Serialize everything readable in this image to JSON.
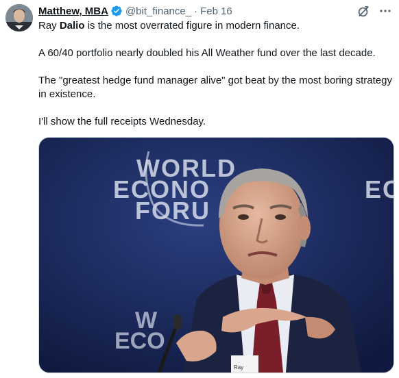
{
  "tweet": {
    "author_name": "Matthew, MBA",
    "handle": "@bit_finance_",
    "separator": "·",
    "date": "Feb 16",
    "body": {
      "line1_prefix": "Ray ",
      "line1_bold": "Dalio",
      "line1_suffix": " is the most overrated figure in modern finance.",
      "para2": "A 60/40 portfolio nearly doubled his All Weather fund over the last decade.",
      "para3": "The \"greatest hedge fund manager alive\" got beat by the most boring strategy in existence.",
      "para4": "I'll show the full receipts Wednesday."
    }
  },
  "media": {
    "backdrop_text": {
      "line1": "WORLD",
      "line2": "ECONO",
      "line3": "FORU",
      "right_text": "EC",
      "lower1": "W",
      "lower2": "ECO"
    },
    "badge_text": "Ray"
  },
  "icons": {
    "verified": "verified-badge-icon",
    "grok": "grok-icon",
    "more": "more-options-icon"
  },
  "colors": {
    "verified": "#1d9bf0",
    "muted": "#536471",
    "text": "#0f1419",
    "backdrop": "#1d2f66"
  }
}
